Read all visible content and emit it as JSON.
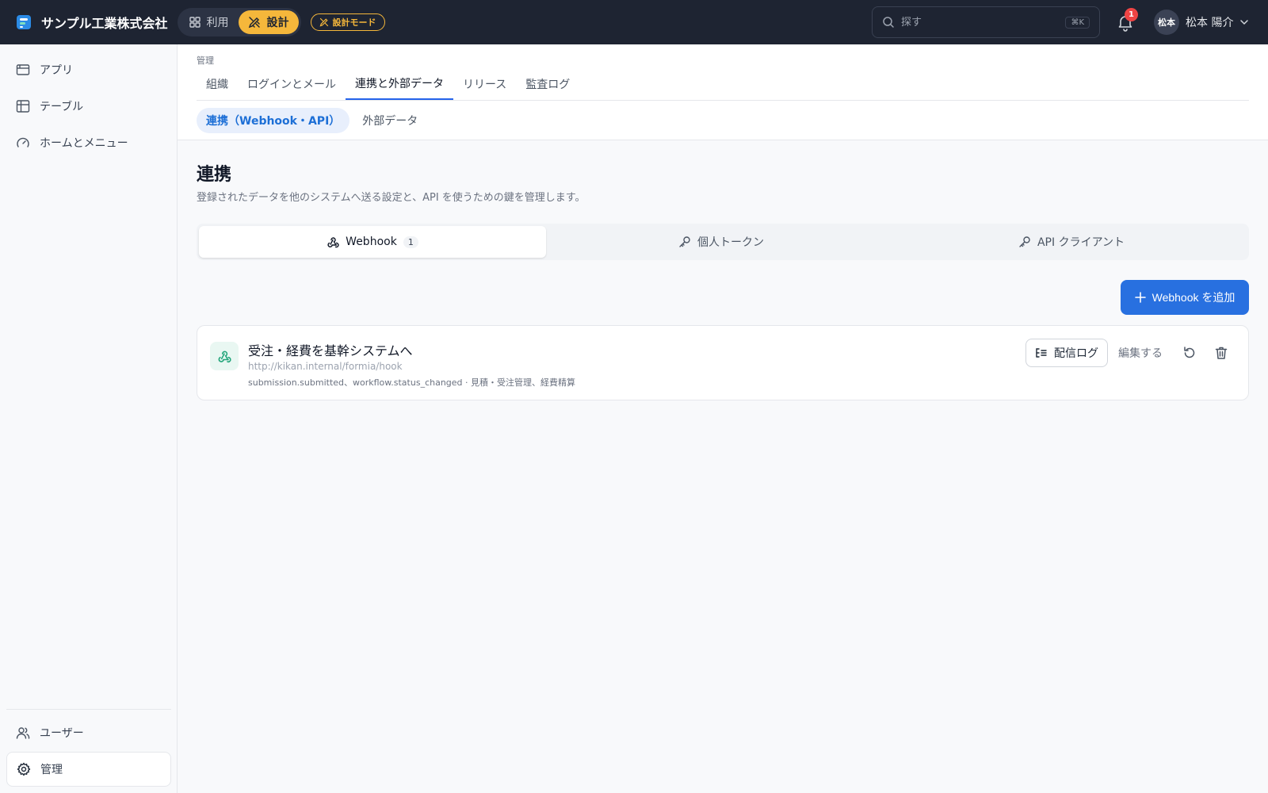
{
  "header": {
    "company": "サンプル工業株式会社",
    "mode_use": "利用",
    "mode_design": "設計",
    "design_badge": "設計モード",
    "search_placeholder": "探す",
    "search_shortcut": "⌘K",
    "notification_count": "1",
    "avatar_text": "松本",
    "user_name": "松本 陽介"
  },
  "sidebar": {
    "items": [
      {
        "label": "アプリ",
        "icon": "app-window-icon"
      },
      {
        "label": "テーブル",
        "icon": "table-icon"
      },
      {
        "label": "ホームとメニュー",
        "icon": "gauge-icon"
      }
    ],
    "bottom_items": [
      {
        "label": "ユーザー",
        "icon": "users-icon"
      },
      {
        "label": "管理",
        "icon": "gear-icon"
      }
    ]
  },
  "admin": {
    "breadcrumb": "管理",
    "tabs": [
      "組織",
      "ログインとメール",
      "連携と外部データ",
      "リリース",
      "監査ログ"
    ],
    "subtabs": [
      "連携（Webhook・API）",
      "外部データ"
    ]
  },
  "page": {
    "title": "連携",
    "description": "登録されたデータを他のシステムへ送る設定と、API を使うための鍵を管理します。"
  },
  "segments": {
    "webhook_label": "Webhook",
    "webhook_count": "1",
    "token_label": "個人トークン",
    "client_label": "API クライアント"
  },
  "actions": {
    "add_webhook": "Webhook を追加"
  },
  "webhook": {
    "title": "受注・経費を基幹システムへ",
    "url": "http://kikan.internal/formia/hook",
    "meta": "submission.submitted、workflow.status_changed · 見積・受注管理、経費精算",
    "log_button": "配信ログ",
    "edit_button": "編集する"
  },
  "colors": {
    "header_bg": "#1e2432",
    "accent_yellow": "#f5b73b",
    "primary_blue": "#2870e0",
    "webhook_green": "#22a57a"
  }
}
